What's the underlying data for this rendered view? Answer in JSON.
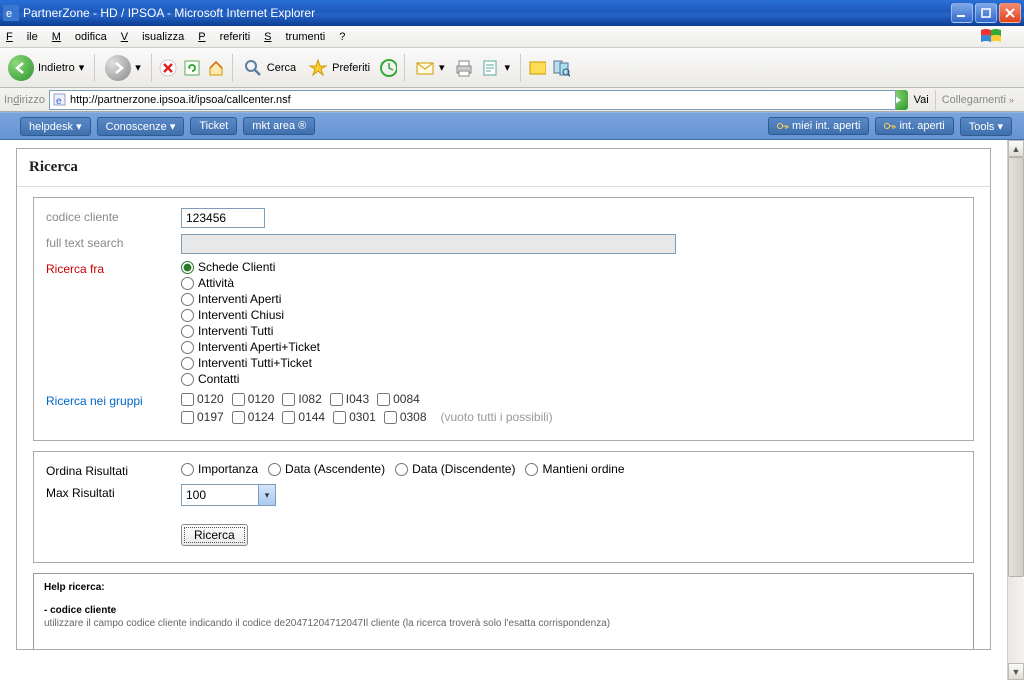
{
  "window": {
    "title": "PartnerZone - HD / IPSOA - Microsoft Internet Explorer"
  },
  "menu": {
    "file": "File",
    "modifica": "Modifica",
    "visualizza": "Visualizza",
    "preferiti": "Preferiti",
    "strumenti": "Strumenti",
    "help": "?"
  },
  "toolbar": {
    "indietro": "Indietro",
    "cerca": "Cerca",
    "preferiti": "Preferiti"
  },
  "address": {
    "label": "Indirizzo",
    "url": "http://partnerzone.ipsoa.it/ipsoa/callcenter.nsf",
    "vai": "Vai",
    "collegamenti": "Collegamenti"
  },
  "nav": {
    "helpdesk": "helpdesk ▾",
    "conoscenze": "Conoscenze ▾",
    "ticket": "Ticket",
    "mkt": "mkt area ®",
    "miei": "miei int. aperti",
    "int": "int. aperti",
    "tools": "Tools ▾"
  },
  "page": {
    "title": "Ricerca"
  },
  "form": {
    "codice_label": "codice cliente",
    "codice_value": "123456",
    "fulltext_label": "full text search",
    "ricerca_fra_label": "Ricerca fra",
    "ricerca_fra_opts": [
      "Schede Clienti",
      "Attività",
      "Interventi Aperti",
      "Interventi Chiusi",
      "Interventi Tutti",
      "Interventi Aperti+Ticket",
      "Interventi Tutti+Ticket",
      "Contatti"
    ],
    "gruppi_label": "Ricerca nei gruppi",
    "gruppi_1": [
      "0120",
      "0120",
      "I082",
      "I043",
      "0084"
    ],
    "gruppi_2": [
      "0197",
      "0124",
      "0144",
      "0301",
      "0308"
    ],
    "gruppi_hint": "(vuoto tutti i possibili)",
    "ordina_label": "Ordina Risultati",
    "ordina_opts": [
      "Importanza",
      "Data (Ascendente)",
      "Data (Discendente)",
      "Mantieni ordine"
    ],
    "max_label": "Max Risultati",
    "max_value": "100",
    "submit": "Ricerca"
  },
  "help": {
    "title": "Help ricerca:",
    "sub1": "- codice cliente",
    "txt1": "utilizzare il campo codice cliente indicando il codice de20471204712047Il cliente (la ricerca troverà solo l'esatta corrispondenza)"
  }
}
